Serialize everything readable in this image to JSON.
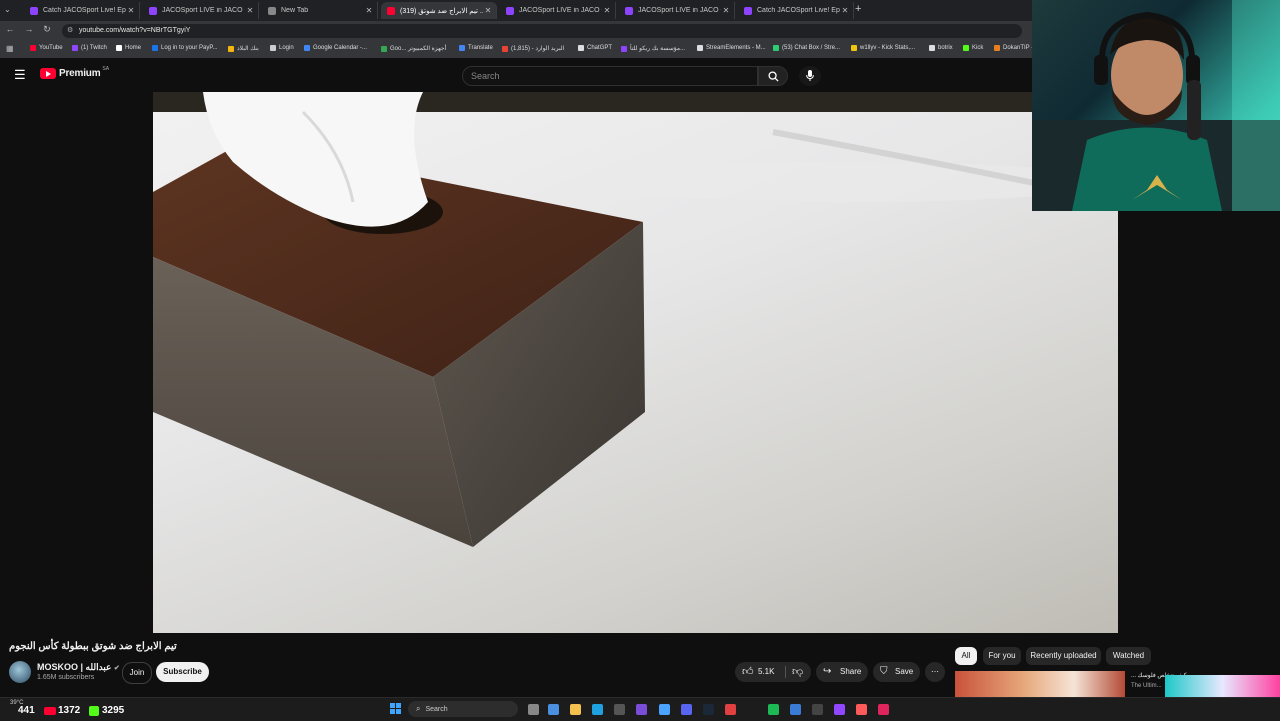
{
  "browser": {
    "tabs": [
      {
        "title": "Catch JACOSport Live! Epic Spe",
        "fav": "#8e44ff"
      },
      {
        "title": "JACOSport LIVE in JACO - JACO",
        "fav": "#8e44ff"
      },
      {
        "title": "New Tab",
        "fav": "#888888"
      },
      {
        "title": "(319) تيم الابراج ضد شوتق ...",
        "fav": "#ff0033"
      },
      {
        "title": "JACOSport LIVE in JACO - JACO",
        "fav": "#8e44ff"
      },
      {
        "title": "JACOSport LIVE in JACO - JACO",
        "fav": "#8e44ff"
      },
      {
        "title": "Catch JACOSport Live! Epic Spe",
        "fav": "#8e44ff"
      }
    ],
    "new_tab_icon": "+",
    "url": "youtube.com/watch?v=NBrTGTgyiY",
    "bookmarks": [
      {
        "label": "YouTube",
        "color": "#ff0033"
      },
      {
        "label": "(1) Twitch",
        "color": "#9146ff"
      },
      {
        "label": "Home",
        "color": "#ffffff"
      },
      {
        "label": "Log in to your PayP...",
        "color": "#1a73e8"
      },
      {
        "label": "بنك البلاد",
        "color": "#f6b40e"
      },
      {
        "label": "Login",
        "color": "#cccccc"
      },
      {
        "label": "Google Calendar -...",
        "color": "#4285f4"
      },
      {
        "label": "Goo... أجهزة الكمبيوتر",
        "color": "#34a853"
      },
      {
        "label": "Translate",
        "color": "#4285f4"
      },
      {
        "label": "البريد الوارد - (1,815)",
        "color": "#ea4335"
      },
      {
        "label": "ChatGPT",
        "color": "#dddddd"
      },
      {
        "label": "مؤسسة بك ريكو للتأ...",
        "color": "#8e44ff"
      },
      {
        "label": "StreamElements - M...",
        "color": "#dddddd"
      },
      {
        "label": "(53) Chat Box / Stre...",
        "color": "#2ecc71"
      },
      {
        "label": "w1llyv - Kick Stats,...",
        "color": "#f1c40f"
      },
      {
        "label": "botrix",
        "color": "#dddddd"
      },
      {
        "label": "Kick",
        "color": "#53fc18"
      },
      {
        "label": "DokanTIP -",
        "color": "#e67e22"
      }
    ]
  },
  "youtube": {
    "logo_text": "Premium",
    "region": "SA",
    "search_placeholder": "Search",
    "video_title": "تيم الابراج ضد شوتق ببطولة كأس النجوم",
    "channel_name": "MOSKOO | عبدالله",
    "subscribers": "1.65M subscribers",
    "join_label": "Join",
    "subscribe_label": "Subscribe",
    "like_count": "5.1K",
    "share_label": "Share",
    "save_label": "Save",
    "chips": [
      "All",
      "For you",
      "Recently uploaded",
      "Watched"
    ],
    "rec_title": "... كيف تتخلص فلوسك",
    "rec_channel": "The Ultim..."
  },
  "taskbar": {
    "weather": "39°C",
    "search_label": "Search"
  },
  "overlay": {
    "stat1": "441",
    "stat2": "1372",
    "stat3": "3295"
  },
  "colors": {
    "accent_red": "#ff0033",
    "kick_green": "#53fc18",
    "webcam_teal": "#33b5a6"
  }
}
